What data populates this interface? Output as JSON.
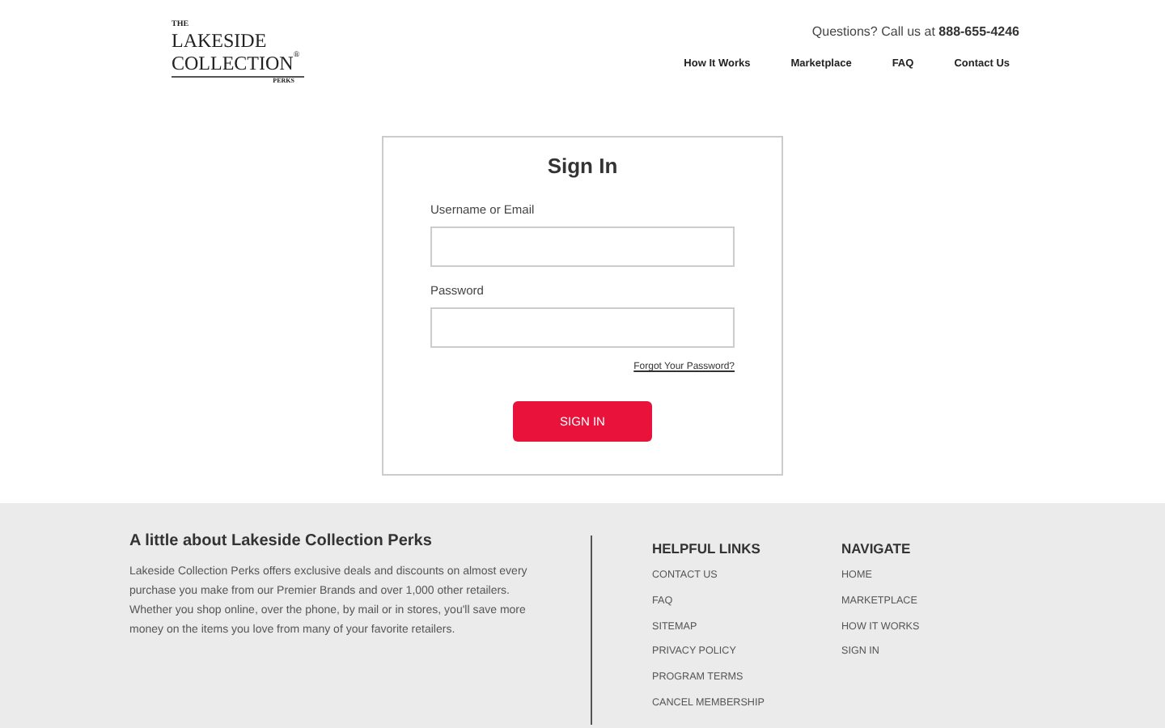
{
  "logo": {
    "top": "THE",
    "line1": "LAKESIDE",
    "line2": "COLLECTION",
    "mark": "®",
    "sub": "PERKS"
  },
  "contact": {
    "text": "Questions? Call us at",
    "phone": "888-655-4246"
  },
  "nav": [
    "How It Works",
    "Marketplace",
    "FAQ",
    "Contact Us"
  ],
  "form": {
    "title": "Sign In",
    "fields": [
      {
        "label": "Username or Email"
      },
      {
        "label": "Password"
      }
    ],
    "forgot": "Forgot Your Password?",
    "button": "SIGN IN"
  },
  "footer": {
    "about_title": "A little about Lakeside Collection Perks",
    "about_text": "Lakeside Collection Perks offers exclusive deals and discounts on almost every purchase you make from our Premier Brands and over 1,000 other retailers. Whether you shop online, over the phone, by mail or in stores, you'll save more money on the items you love from many of your favorite retailers.",
    "columns": [
      {
        "title": "HELPFUL LINKS",
        "links": [
          "CONTACT US",
          "FAQ",
          "SITEMAP",
          "PRIVACY POLICY",
          "PROGRAM TERMS",
          "CANCEL MEMBERSHIP"
        ]
      },
      {
        "title": "NAVIGATE",
        "links": [
          "HOME",
          "MARKETPLACE",
          "HOW IT WORKS",
          "SIGN IN"
        ]
      }
    ]
  }
}
